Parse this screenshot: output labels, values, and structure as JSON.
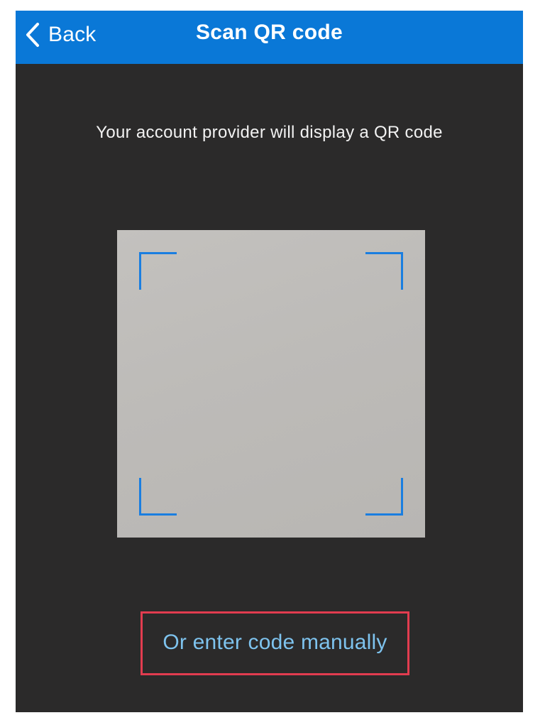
{
  "nav": {
    "back_label": "Back",
    "title": "Scan QR code",
    "background_color": "#0a78d7"
  },
  "scanner": {
    "instruction": "Your account provider will display a QR code",
    "frame_color": "#1a7ee0"
  },
  "manual_entry": {
    "label": "Or enter code manually",
    "link_color": "#7ec3ee",
    "highlight_color": "#e23c4f"
  },
  "icons": {
    "back": "chevron-left-icon"
  }
}
